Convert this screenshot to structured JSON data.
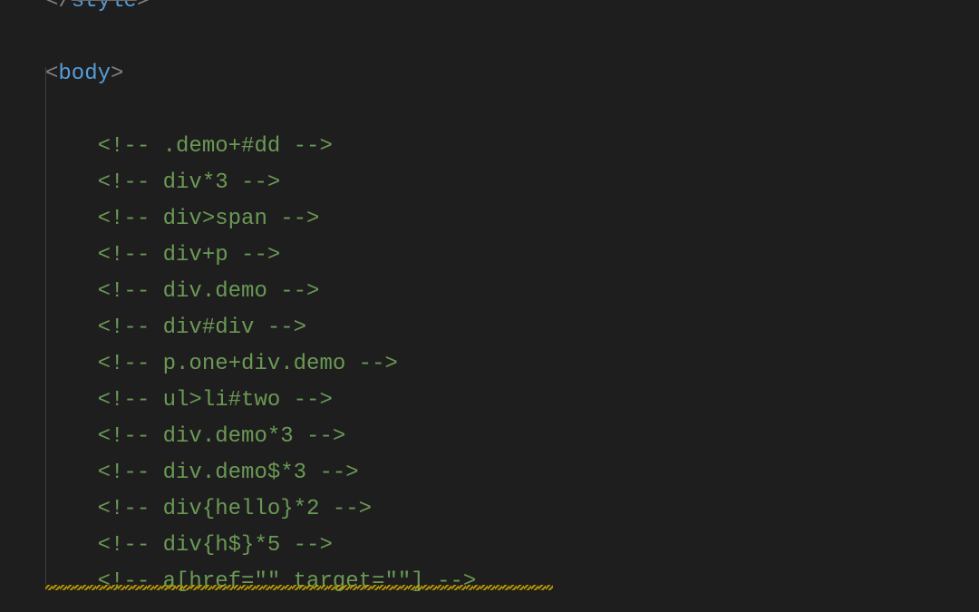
{
  "editor": {
    "lines": [
      {
        "kind": "close-tag",
        "name": "style",
        "striken": true
      },
      {
        "kind": "blank"
      },
      {
        "kind": "open-tag",
        "name": "body"
      },
      {
        "kind": "blank"
      },
      {
        "kind": "comment",
        "text": ".demo+#dd",
        "indent": 2
      },
      {
        "kind": "comment",
        "text": "div*3",
        "indent": 2
      },
      {
        "kind": "comment",
        "text": "div>span",
        "indent": 2
      },
      {
        "kind": "comment",
        "text": "div+p",
        "indent": 2
      },
      {
        "kind": "comment",
        "text": "div.demo",
        "indent": 2
      },
      {
        "kind": "comment",
        "text": "div#div",
        "indent": 2
      },
      {
        "kind": "comment",
        "text": "p.one+div.demo",
        "indent": 2
      },
      {
        "kind": "comment",
        "text": "ul>li#two",
        "indent": 2
      },
      {
        "kind": "comment",
        "text": "div.demo*3",
        "indent": 2
      },
      {
        "kind": "comment",
        "text": "div.demo$*3",
        "indent": 2
      },
      {
        "kind": "comment",
        "text": "div{hello}*2",
        "indent": 2
      },
      {
        "kind": "comment",
        "text": "div{h$}*5",
        "indent": 2
      },
      {
        "kind": "comment",
        "text": "a[href=\"\" target=\"\"]",
        "indent": 2
      }
    ]
  },
  "colors": {
    "background": "#1e1e1e",
    "tag": "#569cd6",
    "punctuation": "#808080",
    "comment": "#6a9955",
    "wavy": "#cca700"
  }
}
